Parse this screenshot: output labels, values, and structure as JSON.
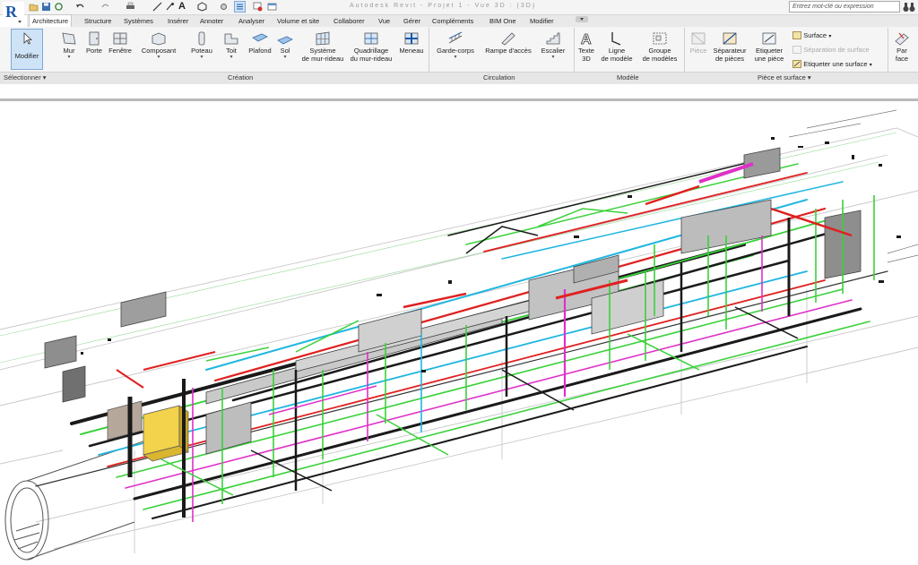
{
  "app": {
    "logo": "R",
    "title_text": "Autodesk Revit - Projet 1 - Vue 3D : {3D}"
  },
  "search": {
    "placeholder": "Entrez mot-clé ou expression",
    "value": ""
  },
  "icons": [
    "open-icon",
    "save-icon",
    "sync-icon",
    "undo-icon",
    "redo-icon",
    "print-icon",
    "measure-icon",
    "dimension-icon",
    "text-icon",
    "view-3d-icon",
    "section-icon",
    "thin-lines-icon",
    "close-windows-icon",
    "switch-windows-icon",
    "binoculars-icon"
  ],
  "tabs": [
    "Architecture",
    "Structure",
    "Systèmes",
    "Insérer",
    "Annoter",
    "Analyser",
    "Volume et site",
    "Collaborer",
    "Vue",
    "Gérer",
    "Compléments",
    "BIM One",
    "Modifier"
  ],
  "active_tab": "Architecture",
  "tools": {
    "modifier": "Modifier",
    "mur": "Mur",
    "porte": "Porte",
    "fenetre": "Fenêtre",
    "composant": "Composant",
    "poteau": "Poteau",
    "toit": "Toit",
    "plafond": "Plafond",
    "sol": "Sol",
    "systeme_line1": "Système",
    "systeme_line2": "de mur-rideau",
    "quadrillage_line1": "Quadrillage",
    "quadrillage_line2": "du mur-rideau",
    "meneau": "Meneau",
    "garde_corps": "Garde-corps",
    "rampe": "Rampe d'accès",
    "escalier": "Escalier",
    "texte3d_line1": "Texte",
    "texte3d_line2": "3D",
    "ligne_line1": "Ligne",
    "ligne_line2": "de modèle",
    "groupe_line1": "Groupe",
    "groupe_line2": "de modèles",
    "piece": "Pièce",
    "separateur_line1": "Séparateur",
    "separateur_line2": "de pièces",
    "etiqueter_line1": "Etiqueter",
    "etiqueter_line2": "une pièce",
    "surface": "Surface",
    "separation_surface": "Séparation de surface",
    "etiqueter_surface": "Etiqueter une surface",
    "par_face_line1": "Par",
    "par_face_line2": "face"
  },
  "panels": {
    "selectionner": "Sélectionner",
    "creation": "Création",
    "circulation": "Circulation",
    "modele": "Modèle",
    "piece_surface": "Pièce et surface"
  },
  "colors": {
    "accent": "#cfe3f7",
    "pipe_green": "#3ad13a",
    "pipe_red": "#e02020",
    "pipe_magenta": "#e030c8",
    "pipe_cyan": "#1fb6e0",
    "pipe_black": "#1a1a1a"
  }
}
